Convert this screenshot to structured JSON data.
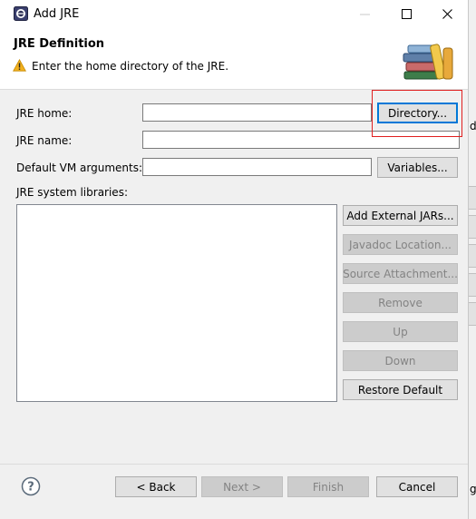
{
  "window": {
    "title": "Add JRE"
  },
  "header": {
    "title": "JRE Definition",
    "message": "Enter the home directory of the JRE."
  },
  "fields": {
    "jre_home_label": "JRE home:",
    "jre_home_value": "",
    "jre_name_label": "JRE name:",
    "jre_name_value": "",
    "vm_args_label": "Default VM arguments:",
    "vm_args_value": "",
    "libraries_label": "JRE system libraries:"
  },
  "buttons": {
    "directory": "Directory...",
    "variables": "Variables...",
    "add_external_jars": "Add External JARs...",
    "javadoc_location": "Javadoc Location...",
    "source_attachment": "Source Attachment...",
    "remove": "Remove",
    "up": "Up",
    "down": "Down",
    "restore_default": "Restore Default"
  },
  "footer": {
    "back": "< Back",
    "next": "Next >",
    "finish": "Finish",
    "cancel": "Cancel"
  },
  "icons": {
    "window": "eclipse-icon",
    "warning": "warning-icon",
    "banner": "books-icon",
    "help": "help-icon"
  },
  "colors": {
    "dialog_background": "#f0f0f0",
    "focus_border": "#0078d7",
    "highlight_box": "#e02020",
    "warning": "#f2b01e"
  }
}
